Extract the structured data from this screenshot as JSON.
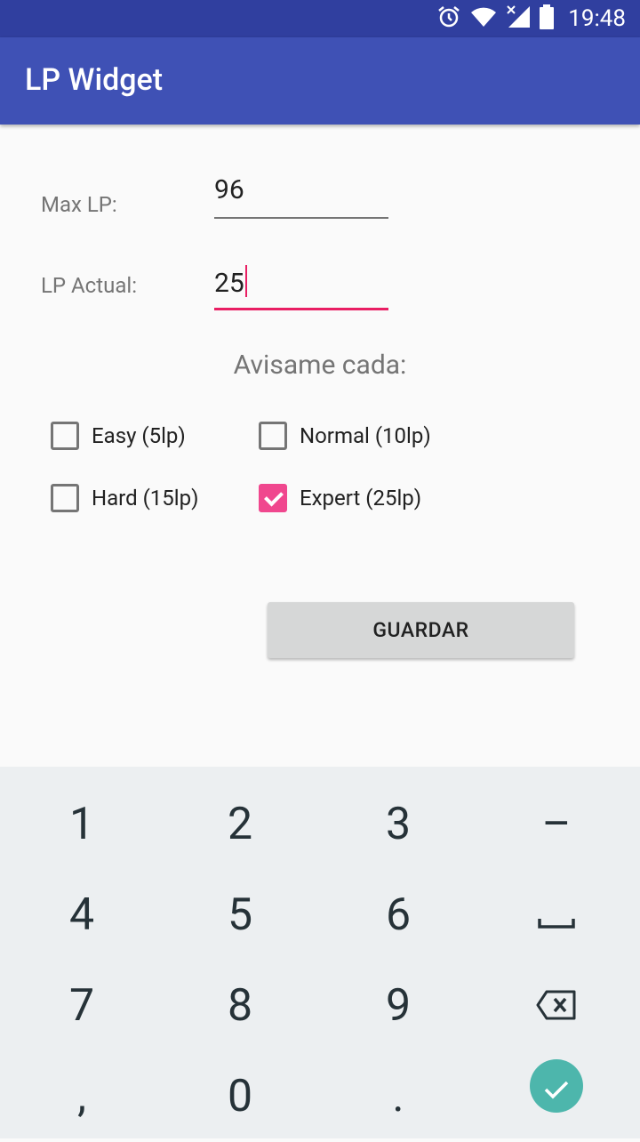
{
  "status_bar": {
    "time": "19:48"
  },
  "app_bar": {
    "title": "LP Widget"
  },
  "form": {
    "max_lp": {
      "label": "Max LP:",
      "value": "96"
    },
    "lp_actual": {
      "label": "LP Actual:",
      "value": "25"
    },
    "notify_heading": "Avisame cada:",
    "options": [
      {
        "label": "Easy (5lp)",
        "checked": false
      },
      {
        "label": "Normal (10lp)",
        "checked": false
      },
      {
        "label": "Hard (15lp)",
        "checked": false
      },
      {
        "label": "Expert (25lp)",
        "checked": true
      }
    ],
    "save_button": "GUARDAR"
  },
  "keyboard": {
    "keys": [
      "1",
      "2",
      "3",
      "–",
      "4",
      "5",
      "6",
      "space-icon",
      "7",
      "8",
      "9",
      "backspace-icon",
      ",",
      "0",
      ".",
      "done-icon"
    ]
  },
  "colors": {
    "status_bar": "#303f9f",
    "app_bar": "#3f51b5",
    "accent": "#e91e63",
    "checked": "#f0478e",
    "done_key": "#4db6ac",
    "keyboard_bg": "#eceff1"
  }
}
